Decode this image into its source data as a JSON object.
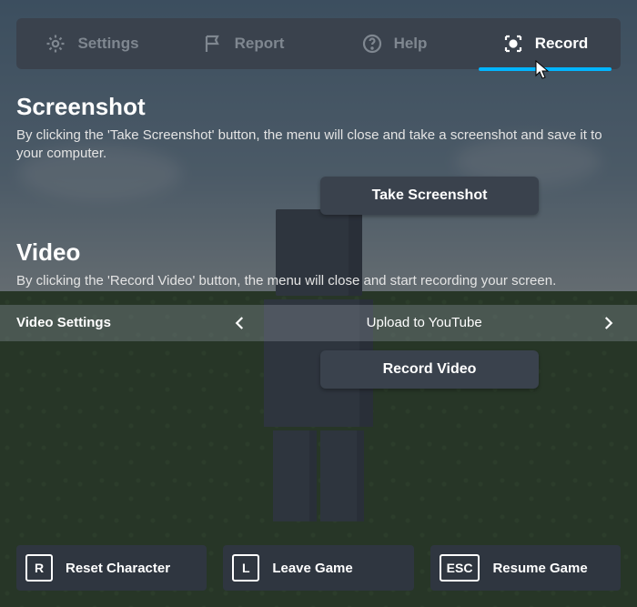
{
  "tabs": {
    "settings": "Settings",
    "report": "Report",
    "help": "Help",
    "record": "Record"
  },
  "screenshot": {
    "title": "Screenshot",
    "desc": "By clicking the 'Take Screenshot' button, the menu will close and take a screenshot and save it to your computer.",
    "button": "Take Screenshot"
  },
  "video": {
    "title": "Video",
    "desc": "By clicking the 'Record Video' button, the menu will close and start recording your screen.",
    "settings_label": "Video Settings",
    "settings_value": "Upload to YouTube",
    "button": "Record Video"
  },
  "bottom": {
    "reset_key": "R",
    "reset_label": "Reset Character",
    "leave_key": "L",
    "leave_label": "Leave Game",
    "resume_key": "ESC",
    "resume_label": "Resume Game"
  }
}
